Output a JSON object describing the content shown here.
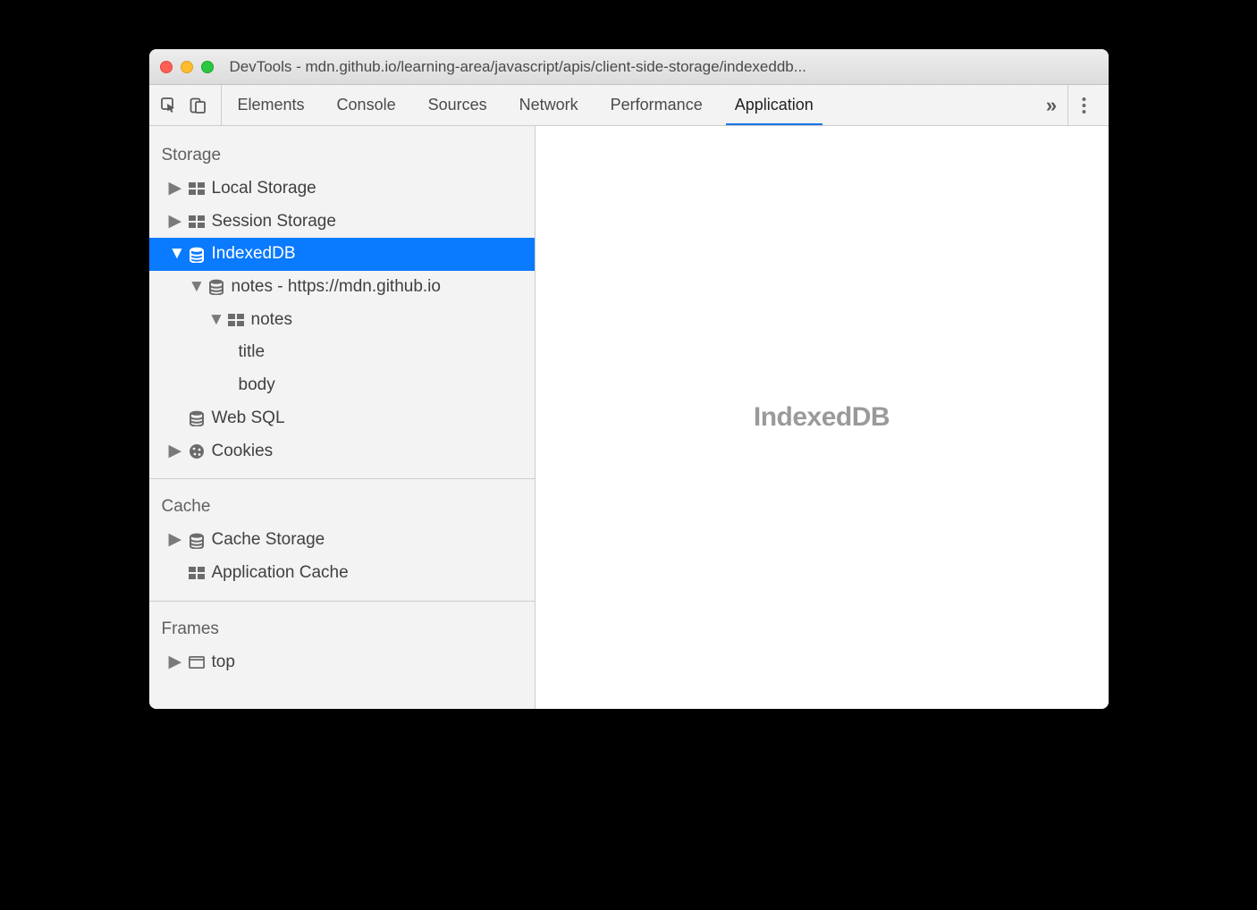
{
  "titlebar": {
    "title": "DevTools - mdn.github.io/learning-area/javascript/apis/client-side-storage/indexeddb..."
  },
  "toolbar": {
    "tabs": [
      "Elements",
      "Console",
      "Sources",
      "Network",
      "Performance",
      "Application"
    ],
    "active_tab": "Application",
    "overflow_glyph": "»"
  },
  "sidebar": {
    "sections": [
      {
        "name": "Storage",
        "items": [
          {
            "label": "Local Storage",
            "icon": "table",
            "expandable": true,
            "expanded": false,
            "depth": 1
          },
          {
            "label": "Session Storage",
            "icon": "table",
            "expandable": true,
            "expanded": false,
            "depth": 1
          },
          {
            "label": "IndexedDB",
            "icon": "db",
            "expandable": true,
            "expanded": true,
            "depth": 1,
            "selected": true
          },
          {
            "label": "notes - https://mdn.github.io",
            "icon": "db",
            "expandable": true,
            "expanded": true,
            "depth": 2
          },
          {
            "label": "notes",
            "icon": "table",
            "expandable": true,
            "expanded": true,
            "depth": 3
          },
          {
            "label": "title",
            "icon": "",
            "expandable": false,
            "depth": 4
          },
          {
            "label": "body",
            "icon": "",
            "expandable": false,
            "depth": 4
          },
          {
            "label": "Web SQL",
            "icon": "db",
            "expandable": false,
            "depth": 1
          },
          {
            "label": "Cookies",
            "icon": "cookie",
            "expandable": true,
            "expanded": false,
            "depth": 1
          }
        ]
      },
      {
        "name": "Cache",
        "items": [
          {
            "label": "Cache Storage",
            "icon": "db",
            "expandable": true,
            "expanded": false,
            "depth": 1
          },
          {
            "label": "Application Cache",
            "icon": "table",
            "expandable": false,
            "depth": 1
          }
        ]
      },
      {
        "name": "Frames",
        "items": [
          {
            "label": "top",
            "icon": "frame",
            "expandable": true,
            "expanded": false,
            "depth": 1
          }
        ]
      }
    ]
  },
  "content": {
    "heading": "IndexedDB"
  }
}
